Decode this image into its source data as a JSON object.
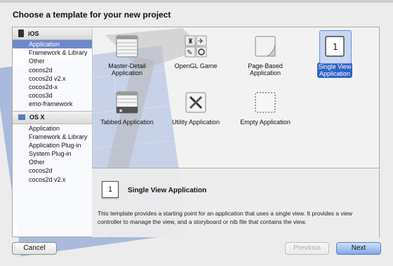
{
  "dialog": {
    "title": "Choose a template for your new project"
  },
  "sidebar": {
    "sections": [
      {
        "label": "iOS",
        "icon": "iphone-icon",
        "items": [
          "Application",
          "Framework & Library",
          "Other",
          "cocos2d",
          "cocos2d v2.x",
          "cocos2d-x",
          "cocos3d",
          "emo-framework"
        ],
        "selected": "Application"
      },
      {
        "label": "OS X",
        "icon": "mac-icon",
        "items": [
          "Application",
          "Framework & Library",
          "Application Plug-in",
          "System Plug-in",
          "Other",
          "cocos2d",
          "cocos2d v2.x"
        ]
      }
    ]
  },
  "templates": [
    {
      "label": "Master-Detail Application",
      "line1": "Master-Detail",
      "line2": "Application",
      "icon": "master-detail-icon"
    },
    {
      "label": "OpenGL Game",
      "line1": "OpenGL Game",
      "line2": "",
      "icon": "opengl-game-icon"
    },
    {
      "label": "Page-Based Application",
      "line1": "Page-Based",
      "line2": "Application",
      "icon": "page-based-icon"
    },
    {
      "label": "Single View Application",
      "line1": "Single View",
      "line2": "Application",
      "icon": "single-view-icon",
      "selected": true
    },
    {
      "label": "Tabbed Application",
      "line1": "Tabbed Application",
      "line2": "",
      "icon": "tabbed-icon"
    },
    {
      "label": "Utility Application",
      "line1": "Utility Application",
      "line2": "",
      "icon": "utility-icon"
    },
    {
      "label": "Empty Application",
      "line1": "Empty Application",
      "line2": "",
      "icon": "empty-icon"
    }
  ],
  "description": {
    "icon_text": "1",
    "title": "Single View Application",
    "text": "This template provides a starting point for an application that uses a single view. It provides a view controller to manage the view, and a storyboard or nib file that contains the view."
  },
  "buttons": {
    "cancel": "Cancel",
    "previous": "Previous",
    "next": "Next"
  },
  "colors": {
    "selection": "#2e63c9",
    "sidebar_selection": "#6e89c9",
    "next_button": "#7ea8ea"
  }
}
